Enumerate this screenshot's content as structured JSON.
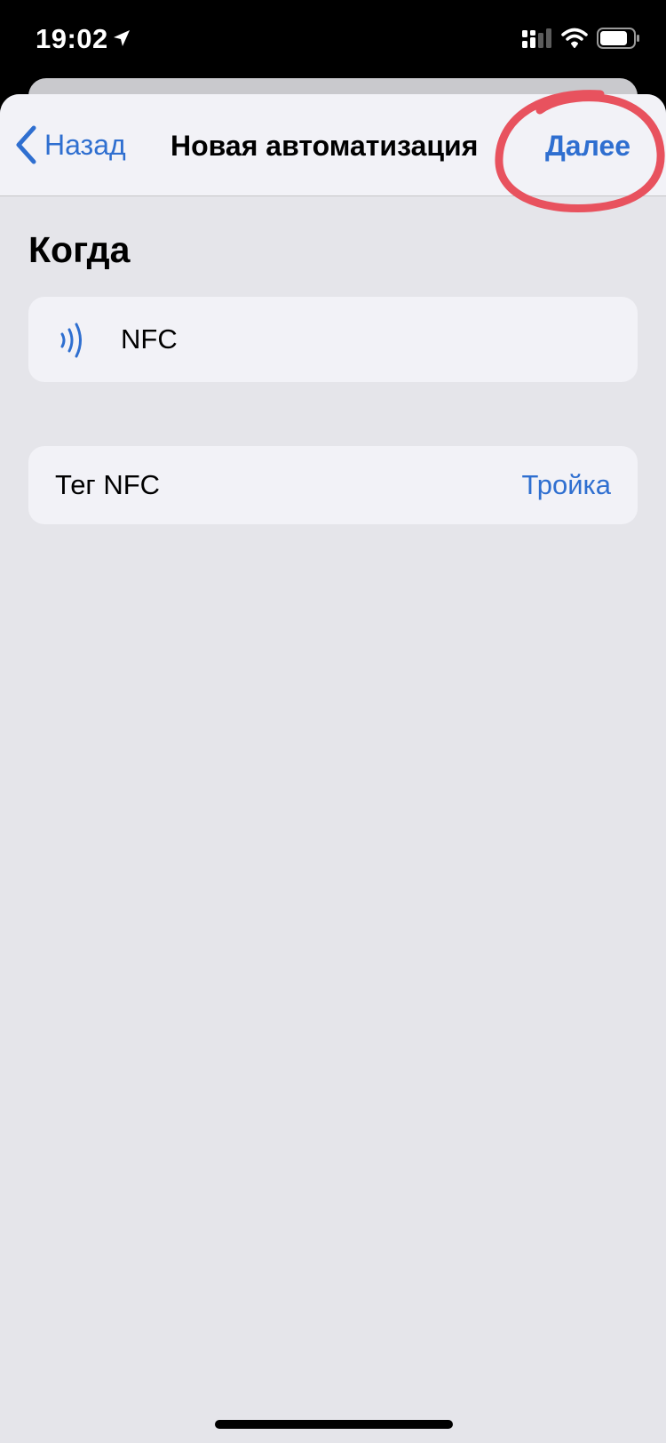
{
  "status_bar": {
    "time": "19:02",
    "icons": [
      "location-arrow-icon",
      "cellular-signal-icon",
      "wifi-icon",
      "battery-icon"
    ]
  },
  "nav": {
    "back_label": "Назад",
    "title": "Новая автоматизация",
    "next_label": "Далее"
  },
  "section": {
    "title": "Когда"
  },
  "trigger": {
    "icon": "nfc-icon",
    "label": "NFC"
  },
  "tag_row": {
    "label": "Тег NFC",
    "value": "Тройка"
  },
  "colors": {
    "accent": "#2f6fd0",
    "background": "#e5e5ea",
    "card": "#f2f2f7",
    "annotation": "#e8525e"
  }
}
